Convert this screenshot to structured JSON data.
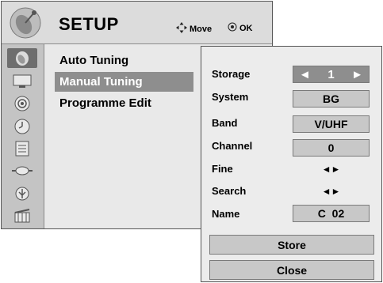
{
  "header": {
    "title": "SETUP",
    "move_hint": "Move",
    "ok_hint": "OK"
  },
  "sidebar": {
    "icons": [
      "setup-icon",
      "picture-icon",
      "audio-icon",
      "time-icon",
      "option-icon",
      "input-icon",
      "usb-icon",
      "movie-icon"
    ],
    "active_index": 0
  },
  "menu": {
    "items": [
      "Auto Tuning",
      "Manual Tuning",
      "Programme Edit"
    ],
    "selected_index": 1
  },
  "panel": {
    "rows": [
      {
        "label": "Storage",
        "value": "1",
        "left_arrow": "◄",
        "right_arrow": "►"
      },
      {
        "label": "System",
        "value": "BG"
      },
      {
        "label": "Band",
        "value": "V/UHF"
      },
      {
        "label": "Channel",
        "value": "0"
      },
      {
        "label": "Fine",
        "value": "◄►"
      },
      {
        "label": "Search",
        "value": "◄►"
      },
      {
        "label": "Name",
        "value": "C  02"
      }
    ],
    "store_button": "Store",
    "close_button": "Close"
  },
  "colors": {
    "selected_bg": "#8e8e8e",
    "panel_bg": "#ececec",
    "box_bg": "#c8c8c8"
  }
}
